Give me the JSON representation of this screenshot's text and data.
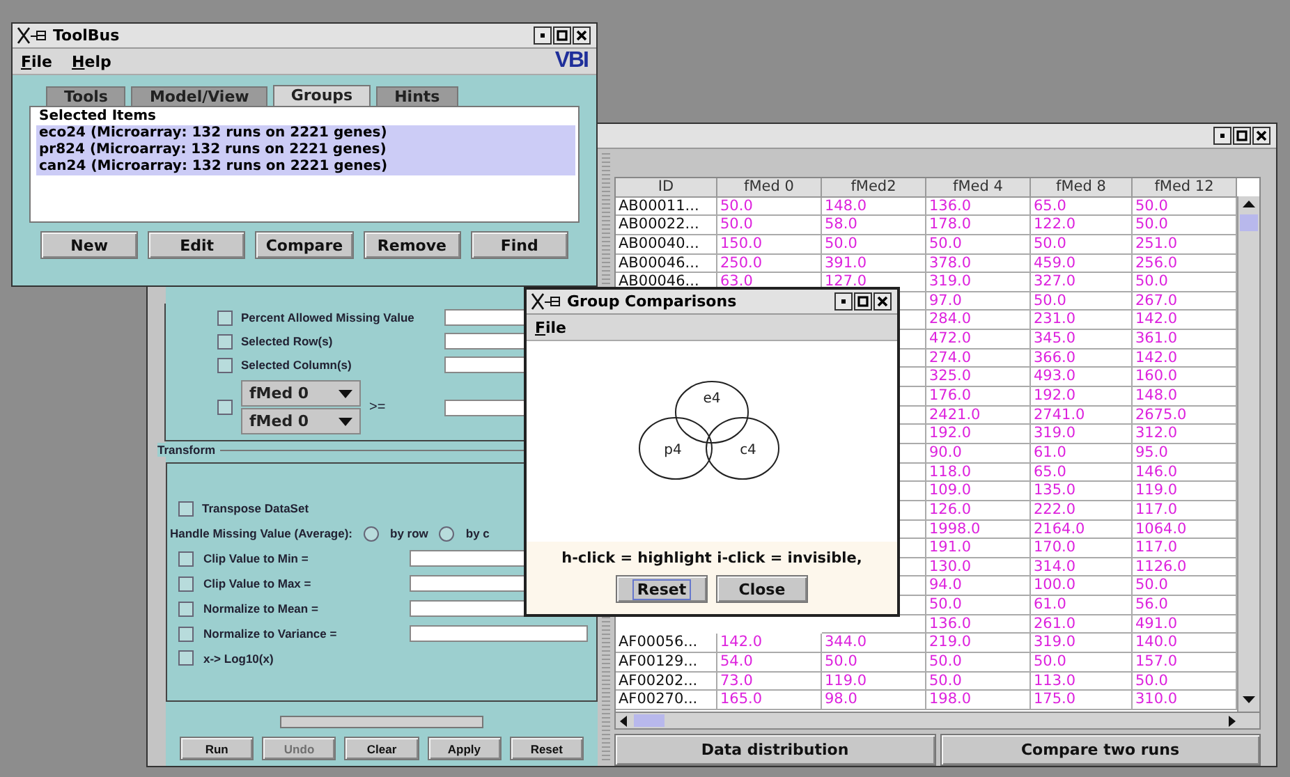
{
  "toolbus": {
    "title": "ToolBus",
    "menu": [
      "File",
      "Help"
    ],
    "logo": "VBI",
    "tabs": [
      {
        "label": "Tools",
        "selected": false
      },
      {
        "label": "Model/View",
        "selected": false
      },
      {
        "label": "Groups",
        "selected": true
      },
      {
        "label": "Hints",
        "selected": false
      }
    ],
    "list": {
      "header": "Selected Items",
      "items": [
        {
          "label": "eco24 (Microarray: 132 runs on 2221 genes)",
          "selected": true
        },
        {
          "label": "pr824 (Microarray: 132 runs on 2221 genes)",
          "selected": true
        },
        {
          "label": "can24 (Microarray: 132 runs on 2221 genes)",
          "selected": true
        }
      ]
    },
    "buttons": [
      "New",
      "Edit",
      "Compare",
      "Remove",
      "Find"
    ]
  },
  "main_window": {
    "filter": {
      "rows": [
        {
          "label": "Percent Allowed Missing Value",
          "checked": false
        },
        {
          "label": "Selected Row(s)",
          "checked": false
        },
        {
          "label": "Selected Column(s)",
          "checked": false
        }
      ],
      "condition": {
        "checked": false,
        "columns": [
          "fMed 0",
          "fMed 0"
        ],
        "operator": ">="
      }
    },
    "transform": {
      "title": "Transform",
      "transpose": {
        "label": "Transpose DataSet",
        "checked": false
      },
      "missing_value": {
        "label": "Handle Missing Value (Average):",
        "options": [
          {
            "label": "by row",
            "selected": false
          },
          {
            "label": "by c",
            "selected": false
          }
        ]
      },
      "options": [
        {
          "label": "Clip Value to Min =",
          "checked": false,
          "kind": "field"
        },
        {
          "label": "Clip Value to Max =",
          "checked": false,
          "kind": "field"
        },
        {
          "label": "Normalize to Mean =",
          "checked": false,
          "kind": "field"
        },
        {
          "label": "Normalize to Variance =",
          "checked": false,
          "kind": "field"
        },
        {
          "label": "x-> Log10(x)",
          "checked": false,
          "kind": "plain"
        }
      ]
    },
    "progress": {
      "level": 0
    },
    "buttons": [
      {
        "label": "Run",
        "disabled": false
      },
      {
        "label": "Undo",
        "disabled": true
      },
      {
        "label": "Clear",
        "disabled": false
      },
      {
        "label": "Apply",
        "disabled": false
      },
      {
        "label": "Reset",
        "disabled": false
      }
    ],
    "table": {
      "columns": [
        "ID",
        "fMed 0",
        "fMed2",
        "fMed 4",
        "fMed 8",
        "fMed 12"
      ],
      "rows": [
        {
          "cells": [
            "AB00011...",
            "50.0",
            "148.0",
            "136.0",
            "65.0",
            "50.0"
          ]
        },
        {
          "cells": [
            "AB00022...",
            "50.0",
            "58.0",
            "178.0",
            "122.0",
            "50.0"
          ]
        },
        {
          "cells": [
            "AB00040...",
            "150.0",
            "50.0",
            "50.0",
            "50.0",
            "251.0"
          ]
        },
        {
          "cells": [
            "AB00046...",
            "250.0",
            "391.0",
            "378.0",
            "459.0",
            "256.0"
          ]
        },
        {
          "cells": [
            "AB00046...",
            "63.0",
            "127.0",
            "319.0",
            "327.0",
            "50.0"
          ]
        },
        {
          "cells": [
            "97.0",
            "50.0",
            "267.0"
          ]
        },
        {
          "cells": [
            "284.0",
            "231.0",
            "142.0"
          ]
        },
        {
          "cells": [
            "472.0",
            "345.0",
            "361.0"
          ]
        },
        {
          "cells": [
            "274.0",
            "366.0",
            "142.0"
          ]
        },
        {
          "cells": [
            "325.0",
            "493.0",
            "160.0"
          ]
        },
        {
          "cells": [
            "176.0",
            "192.0",
            "148.0"
          ]
        },
        {
          "cells": [
            "2421.0",
            "2741.0",
            "2675.0"
          ]
        },
        {
          "cells": [
            "192.0",
            "319.0",
            "312.0"
          ]
        },
        {
          "cells": [
            "90.0",
            "61.0",
            "95.0"
          ]
        },
        {
          "cells": [
            "118.0",
            "65.0",
            "146.0"
          ]
        },
        {
          "cells": [
            "109.0",
            "135.0",
            "119.0"
          ]
        },
        {
          "cells": [
            "126.0",
            "222.0",
            "117.0"
          ]
        },
        {
          "cells": [
            "1998.0",
            "2164.0",
            "1064.0"
          ]
        },
        {
          "cells": [
            "191.0",
            "170.0",
            "117.0"
          ]
        },
        {
          "cells": [
            "130.0",
            "314.0",
            "1126.0"
          ]
        },
        {
          "cells": [
            "94.0",
            "100.0",
            "50.0"
          ]
        },
        {
          "cells": [
            "50.0",
            "61.0",
            "56.0"
          ]
        },
        {
          "cells": [
            "136.0",
            "261.0",
            "491.0"
          ]
        },
        {
          "cells": [
            "AF00056...",
            "142.0",
            "344.0",
            "219.0",
            "319.0",
            "140.0"
          ]
        },
        {
          "cells": [
            "AF00129...",
            "54.0",
            "50.0",
            "50.0",
            "50.0",
            "157.0"
          ]
        },
        {
          "cells": [
            "AF00202...",
            "73.0",
            "119.0",
            "50.0",
            "113.0",
            "50.0"
          ]
        },
        {
          "cells": [
            "AF00270...",
            "165.0",
            "98.0",
            "198.0",
            "175.0",
            "310.0"
          ]
        }
      ]
    },
    "bottom_buttons": [
      "Data distribution",
      "Compare two runs"
    ]
  },
  "group_comparisons": {
    "title": "Group Comparisons",
    "menu": [
      "File"
    ],
    "sets": [
      "e4",
      "p4",
      "c4"
    ],
    "hint": "h-click = highlight i-click = invisible,",
    "buttons": [
      {
        "label": "Reset",
        "focused": true
      },
      {
        "label": "Close",
        "focused": false
      }
    ]
  }
}
